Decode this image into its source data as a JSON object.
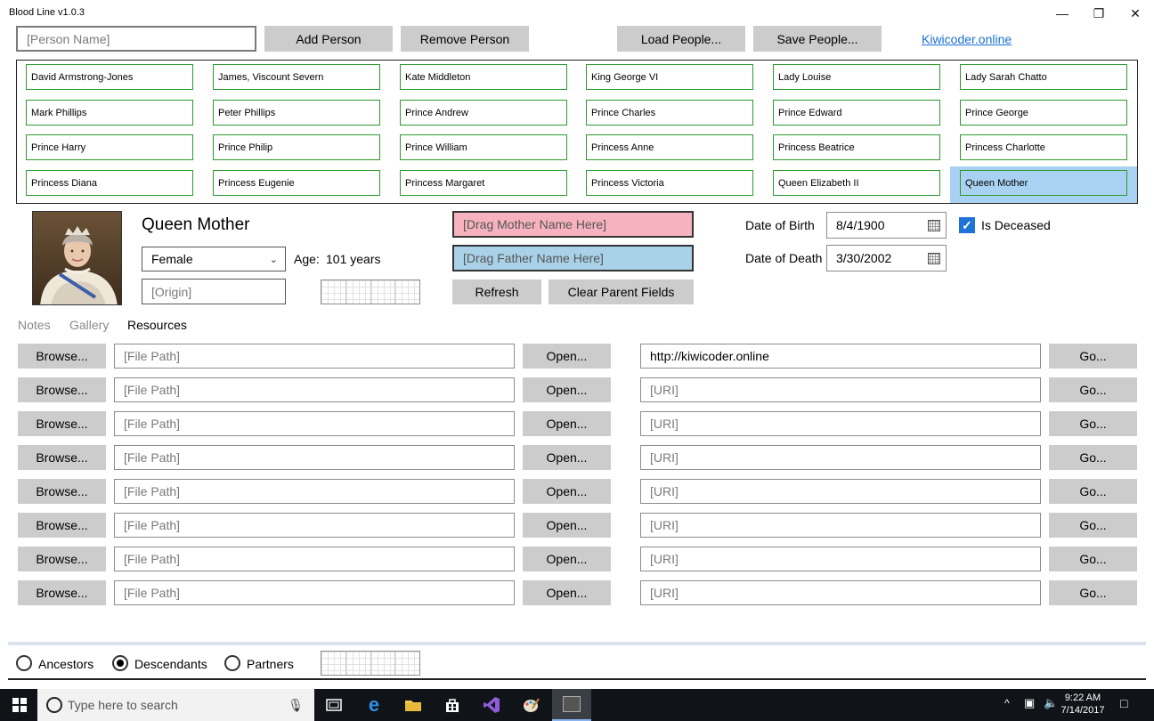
{
  "window": {
    "title": "Blood Line v1.0.3",
    "minimize_glyph": "—",
    "restore_glyph": "❐",
    "close_glyph": "✕"
  },
  "toolbar": {
    "person_name_placeholder": "[Person Name]",
    "add_person": "Add Person",
    "remove_person": "Remove Person",
    "load_people": "Load People...",
    "save_people": "Save People...",
    "link": "Kiwicoder.online"
  },
  "people": [
    [
      "David Armstrong-Jones",
      "James, Viscount Severn",
      "Kate Middleton",
      "King George VI",
      "Lady Louise",
      "Lady Sarah Chatto"
    ],
    [
      "Mark Phillips",
      "Peter Phillips",
      "Prince Andrew",
      "Prince Charles",
      "Prince Edward",
      "Prince George"
    ],
    [
      "Prince Harry",
      "Prince Philip",
      "Prince William",
      "Princess Anne",
      "Princess Beatrice",
      "Princess Charlotte"
    ],
    [
      "Princess Diana",
      "Princess Eugenie",
      "Princess Margaret",
      "Princess Victoria",
      "Queen Elizabeth II",
      "Queen Mother"
    ]
  ],
  "selected_person": "Queen Mother",
  "details": {
    "name": "Queen Mother",
    "gender": "Female",
    "age_label": "Age:",
    "age_value": "101 years",
    "origin_placeholder": "[Origin]",
    "mother_placeholder": "[Drag Mother Name Here]",
    "father_placeholder": "[Drag Father Name Here]",
    "refresh": "Refresh",
    "clear_parents": "Clear Parent Fields",
    "dob_label": "Date of Birth",
    "dob_value": "8/4/1900",
    "dod_label": "Date of Death",
    "dod_value": "3/30/2002",
    "deceased_label": "Is Deceased",
    "deceased": true
  },
  "tabs": [
    "Notes",
    "Gallery",
    "Resources"
  ],
  "active_tab": "Resources",
  "resources": {
    "browse": "Browse...",
    "file_placeholder": "[File Path]",
    "open": "Open...",
    "uri_placeholder": "[URI]",
    "go": "Go...",
    "rows": [
      {
        "file": "",
        "uri": "http://kiwicoder.online"
      },
      {
        "file": "",
        "uri": ""
      },
      {
        "file": "",
        "uri": ""
      },
      {
        "file": "",
        "uri": ""
      },
      {
        "file": "",
        "uri": ""
      },
      {
        "file": "",
        "uri": ""
      },
      {
        "file": "",
        "uri": ""
      },
      {
        "file": "",
        "uri": ""
      }
    ]
  },
  "view_mode": {
    "ancestors": "Ancestors",
    "descendants": "Descendants",
    "partners": "Partners",
    "selected": "Descendants"
  },
  "taskbar": {
    "search_placeholder": "Type here to search",
    "time": "9:22 AM",
    "date": "7/14/2017"
  }
}
